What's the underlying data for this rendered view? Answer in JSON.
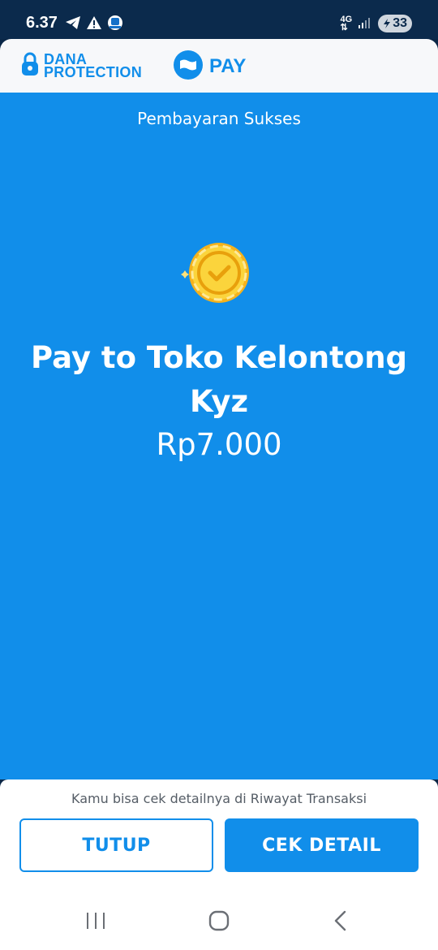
{
  "status_bar": {
    "time": "6.37",
    "network": "4G",
    "battery": "33",
    "icons": [
      "telegram-icon",
      "warning-icon",
      "app-notification-icon",
      "signal-icon"
    ]
  },
  "header": {
    "protection_line1": "DANA",
    "protection_line2": "PROTECTION",
    "pay_label": "PAY"
  },
  "main": {
    "status": "Pembayaran Sukses",
    "merchant": "Pay to Toko Kelontong Kyz",
    "amount": "Rp7.000",
    "icon": "coin-check-icon"
  },
  "footer": {
    "hint": "Kamu bisa cek detailnya di Riwayat Transaksi",
    "close_label": "TUTUP",
    "detail_label": "CEK DETAIL"
  },
  "nav": [
    "recents-icon",
    "home-icon",
    "back-icon"
  ],
  "colors": {
    "brand_blue": "#118eea",
    "coin_gold": "#f7c325",
    "status_bar_bg": "#0b2a4c"
  }
}
